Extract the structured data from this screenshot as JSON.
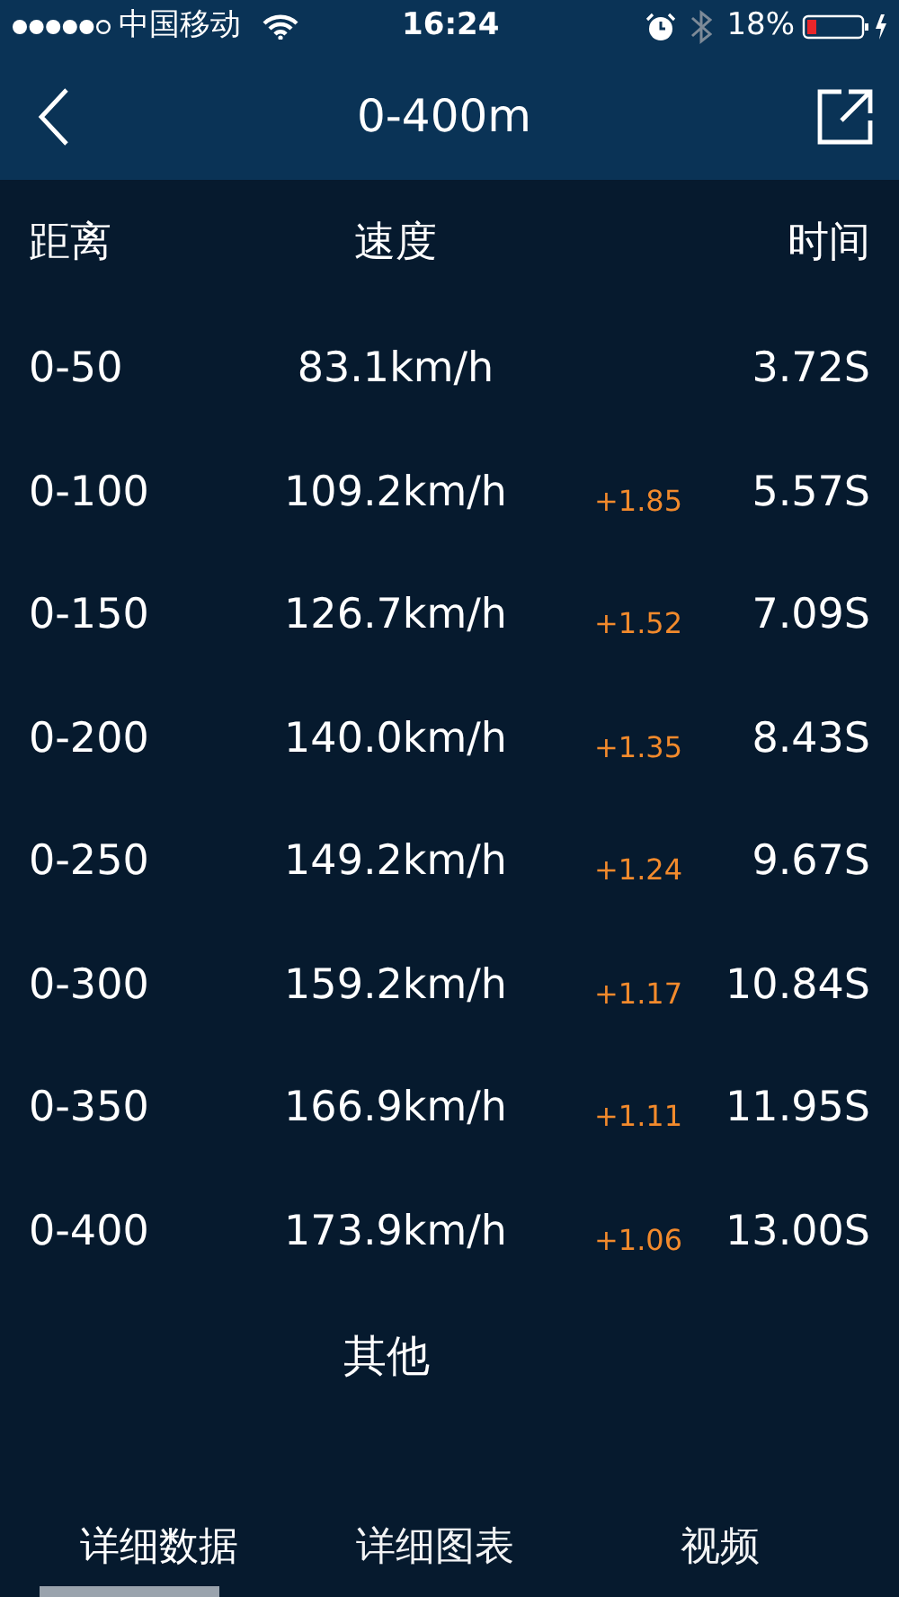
{
  "status_bar": {
    "carrier": "中国移动",
    "time": "16:24",
    "battery": "18%"
  },
  "nav": {
    "title": "0-400m"
  },
  "table": {
    "columns": [
      "距离",
      "速度",
      "时间"
    ],
    "rows": [
      {
        "distance": "0-50",
        "speed": "83.1km/h",
        "time": "3.72S"
      },
      {
        "distance": "0-100",
        "speed": "109.2km/h",
        "gain": "+1.85",
        "time": "5.57S"
      },
      {
        "distance": "0-150",
        "speed": "126.7km/h",
        "gain": "+1.52",
        "time": "7.09S"
      },
      {
        "distance": "0-200",
        "speed": "140.0km/h",
        "gain": "+1.35",
        "time": "8.43S"
      },
      {
        "distance": "0-250",
        "speed": "149.2km/h",
        "gain": "+1.24",
        "time": "9.67S"
      },
      {
        "distance": "0-300",
        "speed": "159.2km/h",
        "gain": "+1.17",
        "time": "10.84S"
      },
      {
        "distance": "0-350",
        "speed": "166.9km/h",
        "gain": "+1.11",
        "time": "11.95S"
      },
      {
        "distance": "0-400",
        "speed": "173.9km/h",
        "gain": "+1.06",
        "time": "13.00S"
      }
    ]
  },
  "section_title": "其他",
  "tabs": [
    {
      "label": "详细数据",
      "selected": true
    },
    {
      "label": "详细图表",
      "selected": false
    },
    {
      "label": "视频",
      "selected": false
    }
  ]
}
